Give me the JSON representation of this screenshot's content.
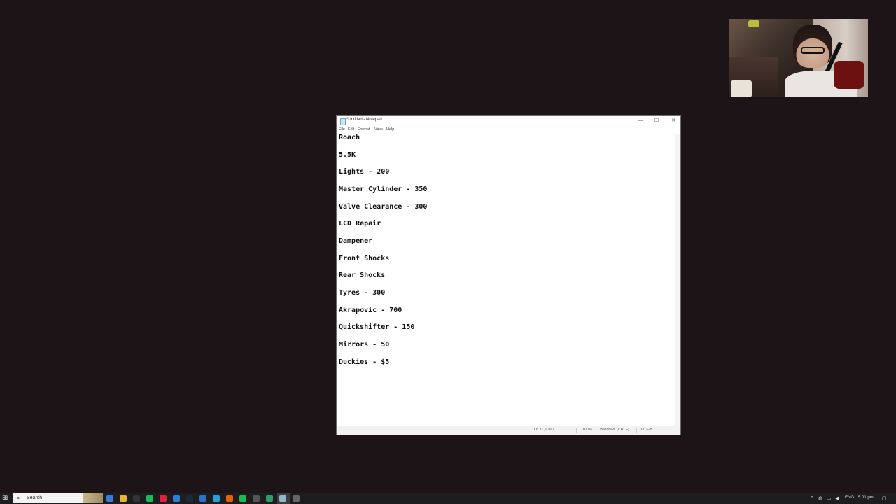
{
  "notepad": {
    "title": "*Untitled - Notepad",
    "menu": [
      "File",
      "Edit",
      "Format",
      "View",
      "Help"
    ],
    "controls": {
      "minimize": "—",
      "maximize": "☐",
      "close": "✕"
    },
    "lines": [
      "Roach",
      "5.5K",
      "Lights - 200",
      "Master Cylinder - 350",
      "Valve Clearance - 300",
      "LCD Repair",
      "Dampener",
      "Front Shocks",
      "Rear Shocks",
      "Tyres - 300",
      "Akrapovic - 700",
      "Quickshifter - 150",
      "Mirrors - 50",
      "Duckies - $5"
    ],
    "status": {
      "position": "Ln 11, Col 1",
      "zoom": "100%",
      "line_ending": "Windows (CRLF)",
      "encoding": "UTF-8"
    }
  },
  "taskbar": {
    "search_label": "Search",
    "language": "ENG",
    "time": "5:01 pm",
    "icons": [
      {
        "name": "task-view-icon",
        "color": "#3a7bd5"
      },
      {
        "name": "file-explorer-icon",
        "color": "#e8b33a"
      },
      {
        "name": "app-icon",
        "color": "#333333"
      },
      {
        "name": "spotify-icon",
        "color": "#1db954"
      },
      {
        "name": "record-icon",
        "color": "#d7263d"
      },
      {
        "name": "browser-icon",
        "color": "#2f7fd1"
      },
      {
        "name": "steam-icon",
        "color": "#1b2838"
      },
      {
        "name": "mail-icon",
        "color": "#2a73c7"
      },
      {
        "name": "edge-icon",
        "color": "#2a9fd6"
      },
      {
        "name": "firefox-icon",
        "color": "#e66000"
      },
      {
        "name": "spotify-icon-2",
        "color": "#1db954"
      },
      {
        "name": "console-icon",
        "color": "#555555"
      },
      {
        "name": "arrow-icon",
        "color": "#2e9c6a"
      },
      {
        "name": "notepad-icon",
        "color": "#8fb8c9"
      },
      {
        "name": "clock-icon",
        "color": "#666666"
      }
    ]
  }
}
